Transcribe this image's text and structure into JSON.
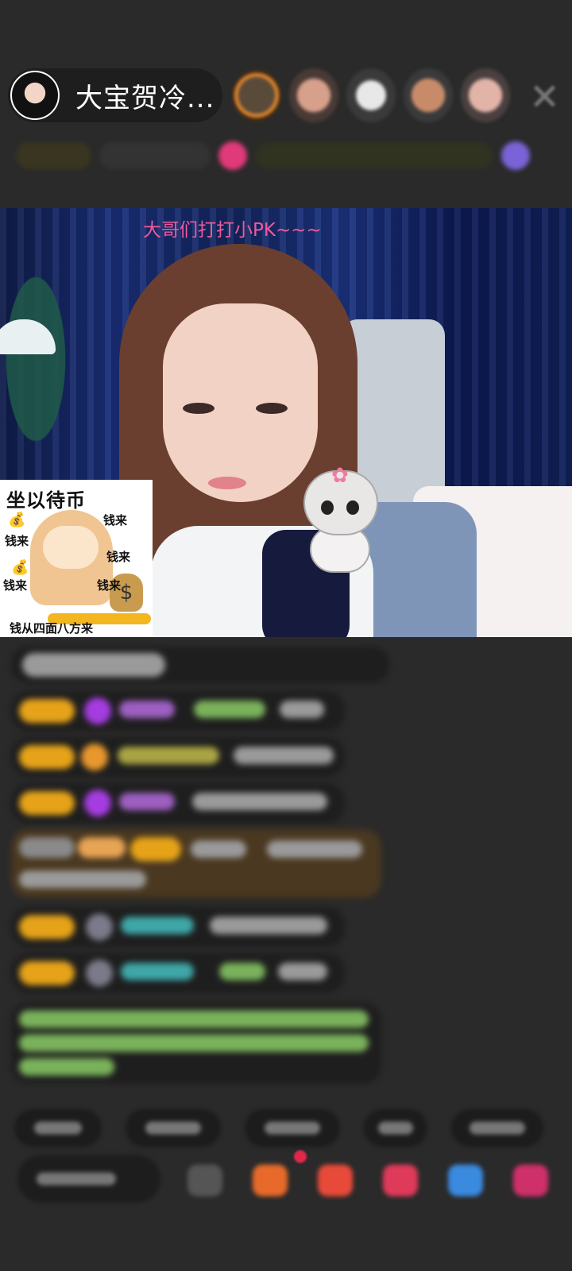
{
  "host": {
    "name": "大宝贺冷..."
  },
  "stream": {
    "overlay_text": "大哥们打打小PK~~~"
  },
  "sticker": {
    "title": "坐以待币",
    "words": [
      "钱来",
      "钱来",
      "钱来",
      "钱来",
      "钱来"
    ],
    "bottom": "钱从四面八方来"
  },
  "colors": {
    "pk_text": "#ef5a9c",
    "badge_gold": "#e6a319",
    "gift_red": "#e0284a"
  }
}
